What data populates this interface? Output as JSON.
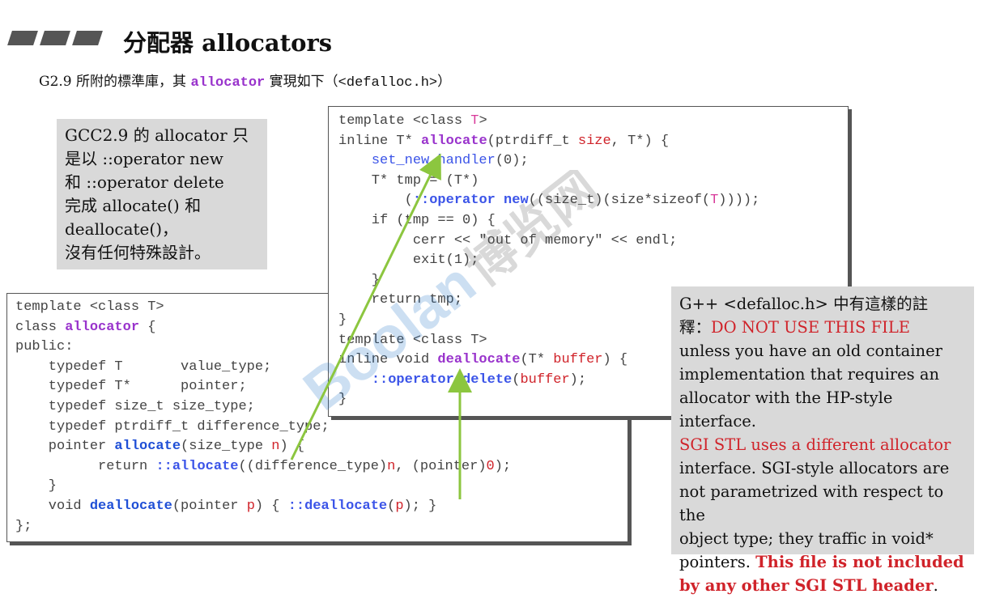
{
  "header": {
    "title": "分配器 allocators",
    "subtitle": {
      "prefix": "G2.9 所附的標準庫，其 ",
      "code": "allocator",
      "mid": " 實現如下（",
      "header_file": "<defalloc.h>",
      "suffix": "）"
    }
  },
  "note": {
    "lines": [
      "GCC2.9 的 allocator 只",
      "是以 ::operator new",
      "和 ::operator delete",
      "完成 allocate() 和",
      "deallocate()，",
      "沒有任何特殊設計。"
    ]
  },
  "code_class": {
    "l1": "template <class T>",
    "l2a": "class ",
    "l2b": "allocator",
    "l2c": " {",
    "l3": "public:",
    "l4": "    typedef T       value_type;",
    "l5": "    typedef T*      pointer;",
    "l6": "    typedef size_t size_type;",
    "l7": "    typedef ptrdiff_t difference_type;",
    "l8a": "    pointer ",
    "l8b": "allocate",
    "l8c": "(size_type ",
    "l8d": "n",
    "l8e": ") {",
    "l9a": "          return ",
    "l9b": "::allocate",
    "l9c": "((difference_type)",
    "l9d": "n",
    "l9e": ", (pointer)",
    "l9f": "0",
    "l9g": ");",
    "l10": "    }",
    "l11a": "    void ",
    "l11b": "deallocate",
    "l11c": "(pointer ",
    "l11d": "p",
    "l11e": ") { ",
    "l11f": "::deallocate",
    "l11g": "(",
    "l11h": "p",
    "l11i": "); }",
    "l12": "};"
  },
  "code_funcs": {
    "l1a": "template <class ",
    "l1b": "T",
    "l1c": ">",
    "l2a": "inline T* ",
    "l2b": "allocate",
    "l2c": "(ptrdiff_t ",
    "l2d": "size",
    "l2e": ", T*) {",
    "l3a": "    ",
    "l3b": "set_new_handler",
    "l3c": "(0);",
    "l4": "    T* tmp = (T*)",
    "l5a": "        (",
    "l5b": "::operator new",
    "l5c": "((size_t)(size*sizeof(",
    "l5d": "T",
    "l5e": "))));",
    "l6": "    if (tmp == 0) {",
    "l7": "         cerr << \"out of memory\" << endl;",
    "l8": "         exit(1);",
    "l9": "    }",
    "l10": "    return tmp;",
    "l11": "}",
    "l12": "template <class T>",
    "l13a": "inline void ",
    "l13b": "deallocate",
    "l13c": "(T* ",
    "l13d": "buffer",
    "l13e": ") {",
    "l14a": "    ",
    "l14b": "::operator delete",
    "l14c": "(",
    "l14d": "buffer",
    "l14e": ");",
    "l15": "}"
  },
  "gcc_note": {
    "p1": "G++ <defalloc.h> 中有這樣的註",
    "p2a": "釋：",
    "p2b": "DO NOT USE THIS FILE",
    "p3": "unless you have an old container",
    "p4": "implementation that requires an",
    "p5": "allocator with the HP-style interface.",
    "p6": "SGI STL uses a different allocator",
    "p7": "interface.  SGI-style allocators are",
    "p8": "not parametrized with respect to the",
    "p9": "object type; they traffic in void*",
    "p10a": "pointers.  ",
    "p10b": "This file is not included",
    "p11a": "by any other SGI STL header",
    "p11b": "."
  },
  "watermark": {
    "text": "Boolan",
    "cn": "博览网"
  },
  "colors": {
    "arrow": "#8cc63f",
    "purple": "#9933cc",
    "blue": "#1f4fd6",
    "red": "#d0232a",
    "note_bg": "#d9d9d9"
  }
}
